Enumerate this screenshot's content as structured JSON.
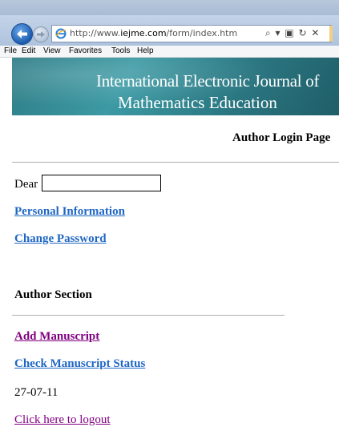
{
  "browser": {
    "url_prefix": "http://www.",
    "url_host": "iejme.com",
    "url_path": "/form/index.htm",
    "address_tools": "⌕ ▾ ▣ ↻ ✕",
    "menu": [
      "File",
      "Edit",
      "View",
      "Favorites",
      "Tools",
      "Help"
    ]
  },
  "banner": {
    "line1": "International Electronic Journal of",
    "line2": "Mathematics Education"
  },
  "page": {
    "title": "Author Login Page",
    "dear_label": "Dear",
    "dear_value": "",
    "links": {
      "personal_info": "Personal Information",
      "change_password": "Change Password"
    },
    "author_section": {
      "title": "Author Section",
      "add_manuscript": "Add Manuscript",
      "check_status": "Check Manuscript Status"
    },
    "date": "27-07-11",
    "logout": "Click here to logout"
  },
  "colors": {
    "link_blue": "#1f66c4",
    "link_visited": "#800080",
    "banner_teal": "#3c9aa4"
  },
  "icons": [
    "back-arrow-icon",
    "forward-arrow-icon",
    "ie-logo-icon",
    "search-icon",
    "refresh-icon",
    "stop-icon"
  ]
}
